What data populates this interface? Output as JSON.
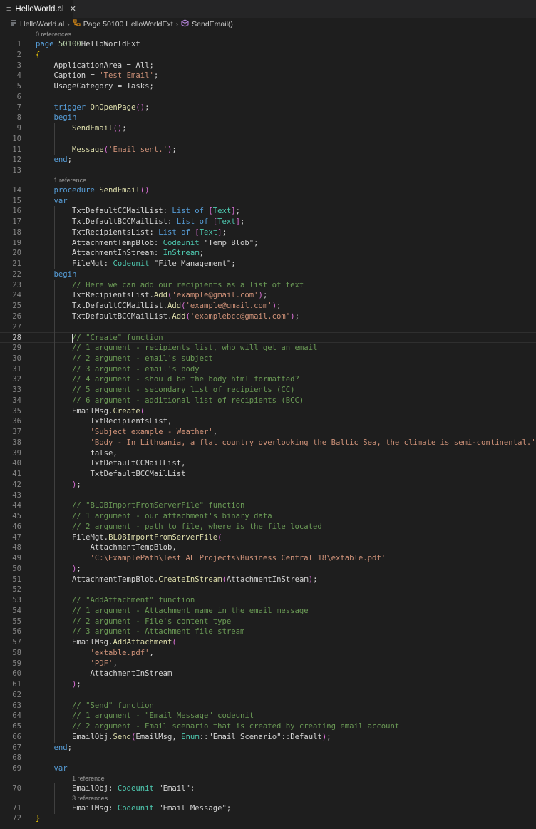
{
  "tab": {
    "icon": "≡",
    "title": "HelloWorld.al",
    "close": "✕"
  },
  "breadcrumb": {
    "file": "HelloWorld.al",
    "page": "Page 50100 HelloWorldExt",
    "method": "SendEmail()"
  },
  "editor": {
    "active_line": 28,
    "lines": [
      {
        "lens": "0 references",
        "lens_indent": 0
      },
      {
        "n": "1",
        "s": [
          [
            "k",
            "page "
          ],
          [
            "n",
            "50100"
          ],
          [
            "",
            "HelloWorldExt"
          ]
        ]
      },
      {
        "n": "2",
        "s": [
          [
            "b",
            "{"
          ]
        ]
      },
      {
        "n": "3",
        "s": [
          [
            "",
            "    ApplicationArea = All;"
          ]
        ]
      },
      {
        "n": "4",
        "s": [
          [
            "",
            "    Caption = "
          ],
          [
            "s",
            "'Test Email'"
          ],
          [
            "",
            ";"
          ]
        ]
      },
      {
        "n": "5",
        "s": [
          [
            "",
            "    UsageCategory = Tasks;"
          ]
        ]
      },
      {
        "n": "6",
        "s": []
      },
      {
        "n": "7",
        "s": [
          [
            "k",
            "    trigger "
          ],
          [
            "f",
            "OnOpenPage"
          ],
          [
            "p",
            "()"
          ],
          [
            "",
            ";"
          ]
        ]
      },
      {
        "n": "8",
        "s": [
          [
            "k",
            "    begin"
          ]
        ]
      },
      {
        "n": "9",
        "s": [
          [
            "f",
            "        SendEmail"
          ],
          [
            "p",
            "()"
          ],
          [
            "",
            ";"
          ]
        ]
      },
      {
        "n": "10",
        "s": []
      },
      {
        "n": "11",
        "s": [
          [
            "f",
            "        Message"
          ],
          [
            "p",
            "("
          ],
          [
            "s",
            "'Email sent.'"
          ],
          [
            "p",
            ")"
          ],
          [
            "",
            ";"
          ]
        ]
      },
      {
        "n": "12",
        "s": [
          [
            "k",
            "    end"
          ],
          [
            "",
            ";"
          ]
        ]
      },
      {
        "n": "13",
        "s": []
      },
      {
        "lens": "1 reference",
        "lens_indent": 4
      },
      {
        "n": "14",
        "s": [
          [
            "k",
            "    procedure "
          ],
          [
            "f",
            "SendEmail"
          ],
          [
            "p",
            "()"
          ]
        ]
      },
      {
        "n": "15",
        "s": [
          [
            "k",
            "    var"
          ]
        ]
      },
      {
        "n": "16",
        "s": [
          [
            "",
            "        TxtDefaultCCMailList: "
          ],
          [
            "k",
            "List of "
          ],
          [
            "p",
            "["
          ],
          [
            "t",
            "Text"
          ],
          [
            "p",
            "]"
          ],
          [
            "",
            ";"
          ]
        ]
      },
      {
        "n": "17",
        "s": [
          [
            "",
            "        TxtDefaultBCCMailList: "
          ],
          [
            "k",
            "List of "
          ],
          [
            "p",
            "["
          ],
          [
            "t",
            "Text"
          ],
          [
            "p",
            "]"
          ],
          [
            "",
            ";"
          ]
        ]
      },
      {
        "n": "18",
        "s": [
          [
            "",
            "        TxtRecipientsList: "
          ],
          [
            "k",
            "List of "
          ],
          [
            "p",
            "["
          ],
          [
            "t",
            "Text"
          ],
          [
            "p",
            "]"
          ],
          [
            "",
            ";"
          ]
        ]
      },
      {
        "n": "19",
        "s": [
          [
            "",
            "        AttachmentTempBlob: "
          ],
          [
            "t",
            "Codeunit "
          ],
          [
            "",
            "\"Temp Blob\";"
          ]
        ]
      },
      {
        "n": "20",
        "s": [
          [
            "",
            "        AttachmentInStream: "
          ],
          [
            "t",
            "InStream"
          ],
          [
            "",
            ";"
          ]
        ]
      },
      {
        "n": "21",
        "s": [
          [
            "",
            "        FileMgt: "
          ],
          [
            "t",
            "Codeunit "
          ],
          [
            "",
            "\"File Management\";"
          ]
        ]
      },
      {
        "n": "22",
        "s": [
          [
            "k",
            "    begin"
          ]
        ]
      },
      {
        "n": "23",
        "s": [
          [
            "c",
            "        // Here we can add our recipients as a list of text"
          ]
        ]
      },
      {
        "n": "24",
        "s": [
          [
            "",
            "        TxtRecipientsList."
          ],
          [
            "f",
            "Add"
          ],
          [
            "p",
            "("
          ],
          [
            "s",
            "'example@gmail.com'"
          ],
          [
            "p",
            ")"
          ],
          [
            "",
            ";"
          ]
        ]
      },
      {
        "n": "25",
        "s": [
          [
            "",
            "        TxtDefaultCCMailList."
          ],
          [
            "f",
            "Add"
          ],
          [
            "p",
            "("
          ],
          [
            "s",
            "'example@gmail.com'"
          ],
          [
            "p",
            ")"
          ],
          [
            "",
            ";"
          ]
        ]
      },
      {
        "n": "26",
        "s": [
          [
            "",
            "        TxtDefaultBCCMailList."
          ],
          [
            "f",
            "Add"
          ],
          [
            "p",
            "("
          ],
          [
            "s",
            "'examplebcc@gmail.com'"
          ],
          [
            "p",
            ")"
          ],
          [
            "",
            ";"
          ]
        ]
      },
      {
        "n": "27",
        "s": []
      },
      {
        "n": "28",
        "s": [
          [
            "c",
            "        // \"Create\" function"
          ]
        ]
      },
      {
        "n": "29",
        "s": [
          [
            "c",
            "        // 1 argument - recipients list, who will get an email"
          ]
        ]
      },
      {
        "n": "30",
        "s": [
          [
            "c",
            "        // 2 argument - email's subject"
          ]
        ]
      },
      {
        "n": "31",
        "s": [
          [
            "c",
            "        // 3 argument - email's body"
          ]
        ]
      },
      {
        "n": "32",
        "s": [
          [
            "c",
            "        // 4 argument - should be the body html formatted?"
          ]
        ]
      },
      {
        "n": "33",
        "s": [
          [
            "c",
            "        // 5 argument - secondary list of recipients (CC)"
          ]
        ]
      },
      {
        "n": "34",
        "s": [
          [
            "c",
            "        // 6 argument - additional list of recipients (BCC)"
          ]
        ]
      },
      {
        "n": "35",
        "s": [
          [
            "",
            "        EmailMsg."
          ],
          [
            "f",
            "Create"
          ],
          [
            "p",
            "("
          ]
        ]
      },
      {
        "n": "36",
        "s": [
          [
            "",
            "            TxtRecipientsList,"
          ]
        ]
      },
      {
        "n": "37",
        "s": [
          [
            "s",
            "            'Subject example - Weather'"
          ],
          [
            "",
            ","
          ]
        ]
      },
      {
        "n": "38",
        "s": [
          [
            "s",
            "            'Body - In Lithuania, a flat country overlooking the Baltic Sea, the climate is semi-continental.'"
          ],
          [
            "",
            ","
          ]
        ]
      },
      {
        "n": "39",
        "s": [
          [
            "",
            "            false,"
          ]
        ]
      },
      {
        "n": "40",
        "s": [
          [
            "",
            "            TxtDefaultCCMailList,"
          ]
        ]
      },
      {
        "n": "41",
        "s": [
          [
            "",
            "            TxtDefaultBCCMailList"
          ]
        ]
      },
      {
        "n": "42",
        "s": [
          [
            "p",
            "        )"
          ],
          [
            "",
            ";"
          ]
        ]
      },
      {
        "n": "43",
        "s": []
      },
      {
        "n": "44",
        "s": [
          [
            "c",
            "        // \"BLOBImportFromServerFile\" function"
          ]
        ]
      },
      {
        "n": "45",
        "s": [
          [
            "c",
            "        // 1 argument - our attachment's binary data"
          ]
        ]
      },
      {
        "n": "46",
        "s": [
          [
            "c",
            "        // 2 argument - path to file, where is the file located"
          ]
        ]
      },
      {
        "n": "47",
        "s": [
          [
            "",
            "        FileMgt."
          ],
          [
            "f",
            "BLOBImportFromServerFile"
          ],
          [
            "p",
            "("
          ]
        ]
      },
      {
        "n": "48",
        "s": [
          [
            "",
            "            AttachmentTempBlob,"
          ]
        ]
      },
      {
        "n": "49",
        "s": [
          [
            "s",
            "            'C:\\ExamplePath\\Test AL Projects\\Business Central 18\\extable.pdf'"
          ]
        ]
      },
      {
        "n": "50",
        "s": [
          [
            "p",
            "        )"
          ],
          [
            "",
            ";"
          ]
        ]
      },
      {
        "n": "51",
        "s": [
          [
            "",
            "        AttachmentTempBlob."
          ],
          [
            "f",
            "CreateInStream"
          ],
          [
            "p",
            "("
          ],
          [
            "",
            "AttachmentInStream"
          ],
          [
            "p",
            ")"
          ],
          [
            "",
            ";"
          ]
        ]
      },
      {
        "n": "52",
        "s": []
      },
      {
        "n": "53",
        "s": [
          [
            "c",
            "        // \"AddAttachment\" function"
          ]
        ]
      },
      {
        "n": "54",
        "s": [
          [
            "c",
            "        // 1 argument - Attachment name in the email message"
          ]
        ]
      },
      {
        "n": "55",
        "s": [
          [
            "c",
            "        // 2 argument - File's content type"
          ]
        ]
      },
      {
        "n": "56",
        "s": [
          [
            "c",
            "        // 3 argument - Attachment file stream"
          ]
        ]
      },
      {
        "n": "57",
        "s": [
          [
            "",
            "        EmailMsg."
          ],
          [
            "f",
            "AddAttachment"
          ],
          [
            "p",
            "("
          ]
        ]
      },
      {
        "n": "58",
        "s": [
          [
            "s",
            "            'extable.pdf'"
          ],
          [
            "",
            ","
          ]
        ]
      },
      {
        "n": "59",
        "s": [
          [
            "s",
            "            'PDF'"
          ],
          [
            "",
            ","
          ]
        ]
      },
      {
        "n": "60",
        "s": [
          [
            "",
            "            AttachmentInStream"
          ]
        ]
      },
      {
        "n": "61",
        "s": [
          [
            "p",
            "        )"
          ],
          [
            "",
            ";"
          ]
        ]
      },
      {
        "n": "62",
        "s": []
      },
      {
        "n": "63",
        "s": [
          [
            "c",
            "        // \"Send\" function"
          ]
        ]
      },
      {
        "n": "64",
        "s": [
          [
            "c",
            "        // 1 argument - \"Email Message\" codeunit"
          ]
        ]
      },
      {
        "n": "65",
        "s": [
          [
            "c",
            "        // 2 argument - Email scenario that is created by creating email account"
          ]
        ]
      },
      {
        "n": "66",
        "s": [
          [
            "",
            "        EmailObj."
          ],
          [
            "f",
            "Send"
          ],
          [
            "p",
            "("
          ],
          [
            "",
            "EmailMsg, "
          ],
          [
            "t",
            "Enum"
          ],
          [
            "",
            "::\"Email Scenario\"::Default"
          ],
          [
            "p",
            ")"
          ],
          [
            "",
            ";"
          ]
        ]
      },
      {
        "n": "67",
        "s": [
          [
            "k",
            "    end"
          ],
          [
            "",
            ";"
          ]
        ]
      },
      {
        "n": "68",
        "s": []
      },
      {
        "n": "69",
        "s": [
          [
            "k",
            "    var"
          ]
        ]
      },
      {
        "lens": "1 reference",
        "lens_indent": 8
      },
      {
        "n": "70",
        "s": [
          [
            "",
            "        EmailObj: "
          ],
          [
            "t",
            "Codeunit "
          ],
          [
            "",
            "\"Email\";"
          ]
        ]
      },
      {
        "lens": "3 references",
        "lens_indent": 8
      },
      {
        "n": "71",
        "s": [
          [
            "",
            "        EmailMsg: "
          ],
          [
            "t",
            "Codeunit "
          ],
          [
            "",
            "\"Email Message\";"
          ]
        ]
      },
      {
        "n": "72",
        "s": [
          [
            "b",
            "}"
          ]
        ]
      }
    ]
  }
}
